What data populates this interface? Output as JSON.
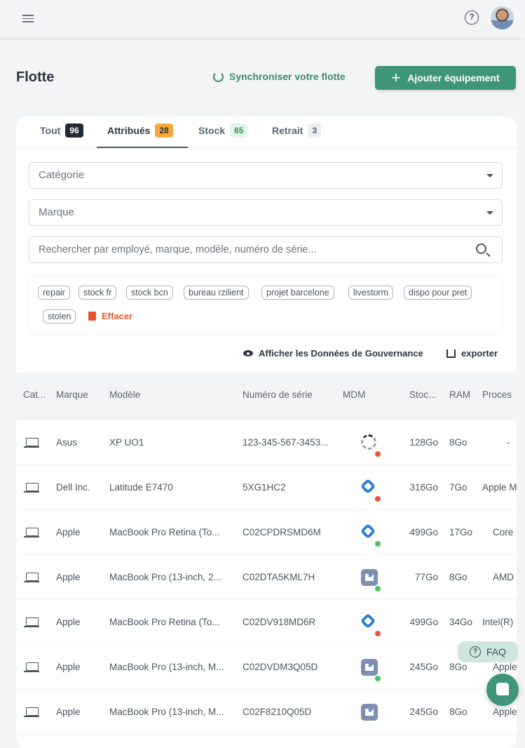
{
  "header": {
    "help_icon": "?"
  },
  "page": {
    "title": "Flotte",
    "sync_label": "Synchroniser votre flotte",
    "add_label": "Ajouter équipement"
  },
  "tabs": [
    {
      "label": "Tout",
      "count": "96",
      "badge_bg": "#222a35",
      "badge_fg": "#ffffff"
    },
    {
      "label": "Attribués",
      "count": "28",
      "badge_bg": "#f5a93a",
      "badge_fg": "#2d3340"
    },
    {
      "label": "Stock",
      "count": "65",
      "badge_bg": "#e3f4e8",
      "badge_fg": "#3b8a55"
    },
    {
      "label": "Retrait",
      "count": "3",
      "badge_bg": "#eceef1",
      "badge_fg": "#5b6472"
    }
  ],
  "active_tab": "Attribués",
  "filters": {
    "category_placeholder": "Catégorie",
    "brand_placeholder": "Marque",
    "search_placeholder": "Rechercher par employé, marque, modèle, numéro de série..."
  },
  "tags": [
    "repair",
    "stock fr",
    "stock bcn",
    "bureau rzilient",
    "projet barcelone",
    "livestorm",
    "dispo pour pret",
    "stolen"
  ],
  "clear_label": "Effacer",
  "governance_label": "Afficher les Données de Gouvernance",
  "export_label": "exporter",
  "table": {
    "headers": [
      "Cat...",
      "Marque",
      "Modèle",
      "Numéro de série",
      "MDM",
      "Stoc...",
      "RAM",
      "Proces"
    ],
    "rows": [
      {
        "brand": "Asus",
        "model": "XP UO1",
        "serial": "123-345-567-3453...",
        "mdm": "loading",
        "status": "red",
        "storage": "128Go",
        "ram": "8Go",
        "cpu": "-"
      },
      {
        "brand": "Dell Inc.",
        "model": "Latitude E7470",
        "serial": "5XG1HC2",
        "mdm": "hexnode",
        "status": "red",
        "storage": "316Go",
        "ram": "7Go",
        "cpu": "Apple M"
      },
      {
        "brand": "Apple",
        "model": "MacBook Pro Retina (To...",
        "serial": "C02CPDRSMD6M",
        "mdm": "hexnode",
        "status": "green",
        "storage": "499Go",
        "ram": "17Go",
        "cpu": "Core"
      },
      {
        "brand": "Apple",
        "model": "MacBook Pro (13-inch, 2...",
        "serial": "C02DTA5KML7H",
        "mdm": "jamf",
        "status": "green",
        "storage": "77Go",
        "ram": "8Go",
        "cpu": "AMD E"
      },
      {
        "brand": "Apple",
        "model": "MacBook Pro Retina (To...",
        "serial": "C02DV918MD6R",
        "mdm": "hexnode",
        "status": "red",
        "storage": "499Go",
        "ram": "34Go",
        "cpu": "Intel(R)"
      },
      {
        "brand": "Apple",
        "model": "MacBook Pro (13-inch, M...",
        "serial": "C02DVDM3Q05D",
        "mdm": "jamf",
        "status": "green",
        "storage": "245Go",
        "ram": "8Go",
        "cpu": "Apple"
      },
      {
        "brand": "Apple",
        "model": "MacBook Pro (13-inch, M...",
        "serial": "C02F8210Q05D",
        "mdm": "jamf",
        "status": "",
        "storage": "245Go",
        "ram": "8Go",
        "cpu": "Apple"
      }
    ]
  },
  "status_colors": {
    "red": "#e9573a",
    "green": "#4cc35a"
  },
  "faq_label": "FAQ"
}
